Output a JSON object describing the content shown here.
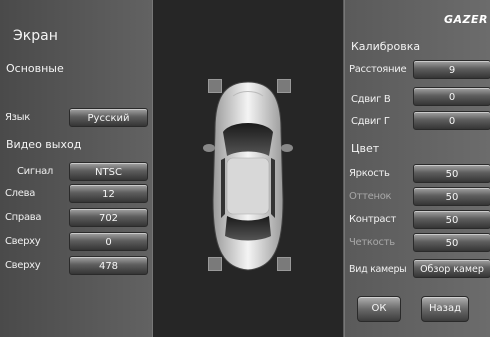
{
  "logo": "GAZER",
  "left": {
    "title": "Экран",
    "main_header": "Основные",
    "language_label": "Язык",
    "language_value": "Русский",
    "video_out_header": "Видео выход",
    "rows": [
      {
        "label": "Сигнал",
        "value": "NTSC"
      },
      {
        "label": "Слева",
        "value": "12"
      },
      {
        "label": "Справа",
        "value": "702"
      },
      {
        "label": "Сверху",
        "value": "0"
      },
      {
        "label": "Сверху",
        "value": "478"
      }
    ]
  },
  "right": {
    "calibration_header": "Калибровка",
    "distance_label": "Расстояние",
    "distance_value": "9",
    "shift_v_label": "Сдвиг В",
    "shift_v_value": "0",
    "shift_h_label": "Сдвиг Г",
    "shift_h_value": "0",
    "color_header": "Цвет",
    "color_rows": [
      {
        "label": "Яркость",
        "value": "50",
        "dim": false
      },
      {
        "label": "Оттенок",
        "value": "50",
        "dim": true
      },
      {
        "label": "Контраст",
        "value": "50",
        "dim": false
      },
      {
        "label": "Четкость",
        "value": "50",
        "dim": true
      }
    ],
    "camera_view_label": "Вид камеры",
    "camera_view_value": "Обзор камер",
    "ok_label": "ОК",
    "back_label": "Назад"
  }
}
